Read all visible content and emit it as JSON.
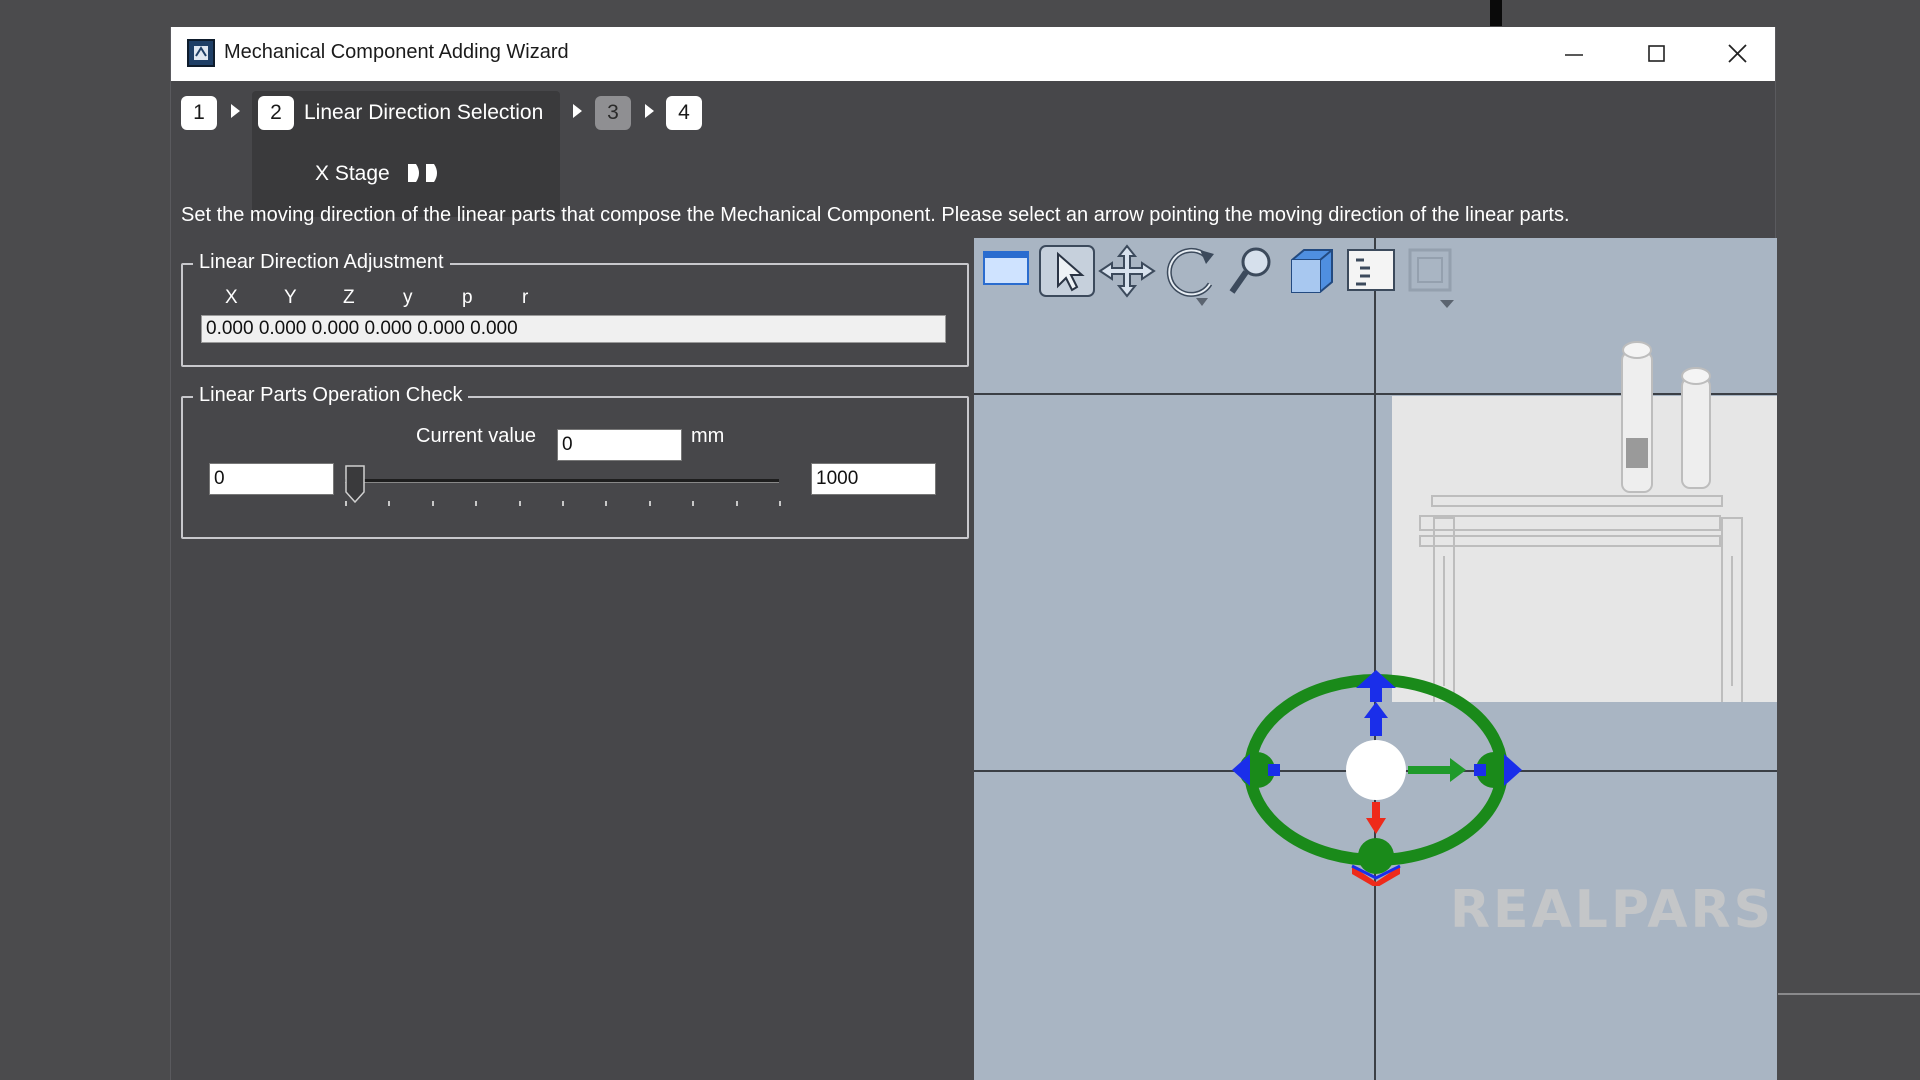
{
  "window": {
    "title": "Mechanical Component Adding Wizard",
    "icon": "app-icon"
  },
  "steps": [
    {
      "number": "1",
      "state": "done"
    },
    {
      "number": "2",
      "state": "active",
      "label": "Linear Direction Selection",
      "sublabel": "X Stage"
    },
    {
      "number": "3",
      "state": "disabled"
    },
    {
      "number": "4",
      "state": "pending"
    }
  ],
  "instruction": "Set the moving direction of the linear parts that compose the Mechanical Component. Please select an arrow pointing the moving direction of the linear parts.",
  "linear_direction": {
    "legend": "Linear Direction Adjustment",
    "axes": [
      "X",
      "Y",
      "Z",
      "y",
      "p",
      "r"
    ],
    "value": "0.000 0.000 0.000 0.000 0.000 0.000"
  },
  "operation_check": {
    "legend": "Linear Parts Operation Check",
    "current_label": "Current value",
    "current_value": "0",
    "unit": "mm",
    "min": "0",
    "max": "1000",
    "slider_fraction": 0.0
  },
  "toolbar": [
    "view-window-icon",
    "select-pointer-icon",
    "move-icon",
    "rotate-icon",
    "zoom-icon",
    "cube-view-icon",
    "list-icon",
    "frame-icon"
  ],
  "colors": {
    "gizmo_ring": "#1a8a1a",
    "gizmo_blue": "#1a2eea",
    "gizmo_red": "#ee2a1a",
    "gizmo_green_arrow": "#1f9a2a",
    "viewport_bg": "#a9b5c3"
  },
  "watermark": "REALPARS"
}
